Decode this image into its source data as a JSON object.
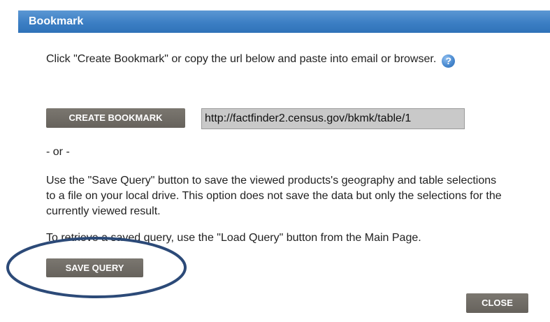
{
  "dialog": {
    "title": "Bookmark",
    "intro_text": "Click \"Create Bookmark\" or copy the url below and paste into email or browser.",
    "help_icon": "help-question-icon",
    "create_button_label": "CREATE BOOKMARK",
    "bookmark_url": "http://factfinder2.census.gov/bkmk/table/1",
    "or_text": "- or -",
    "save_info_text": "Use the \"Save Query\" button to save the viewed products's geography and table selections to a file on your local drive. This option does not save the data but only the selections for the currently viewed result.",
    "retrieve_text": "To retrieve a saved query, use the \"Load Query\" button from the Main Page.",
    "save_button_label": "SAVE QUERY",
    "close_button_label": "CLOSE"
  },
  "colors": {
    "title_bar": "#3c7fc4",
    "button": "#6f6b65",
    "annotation_ellipse": "#2c4a78"
  }
}
